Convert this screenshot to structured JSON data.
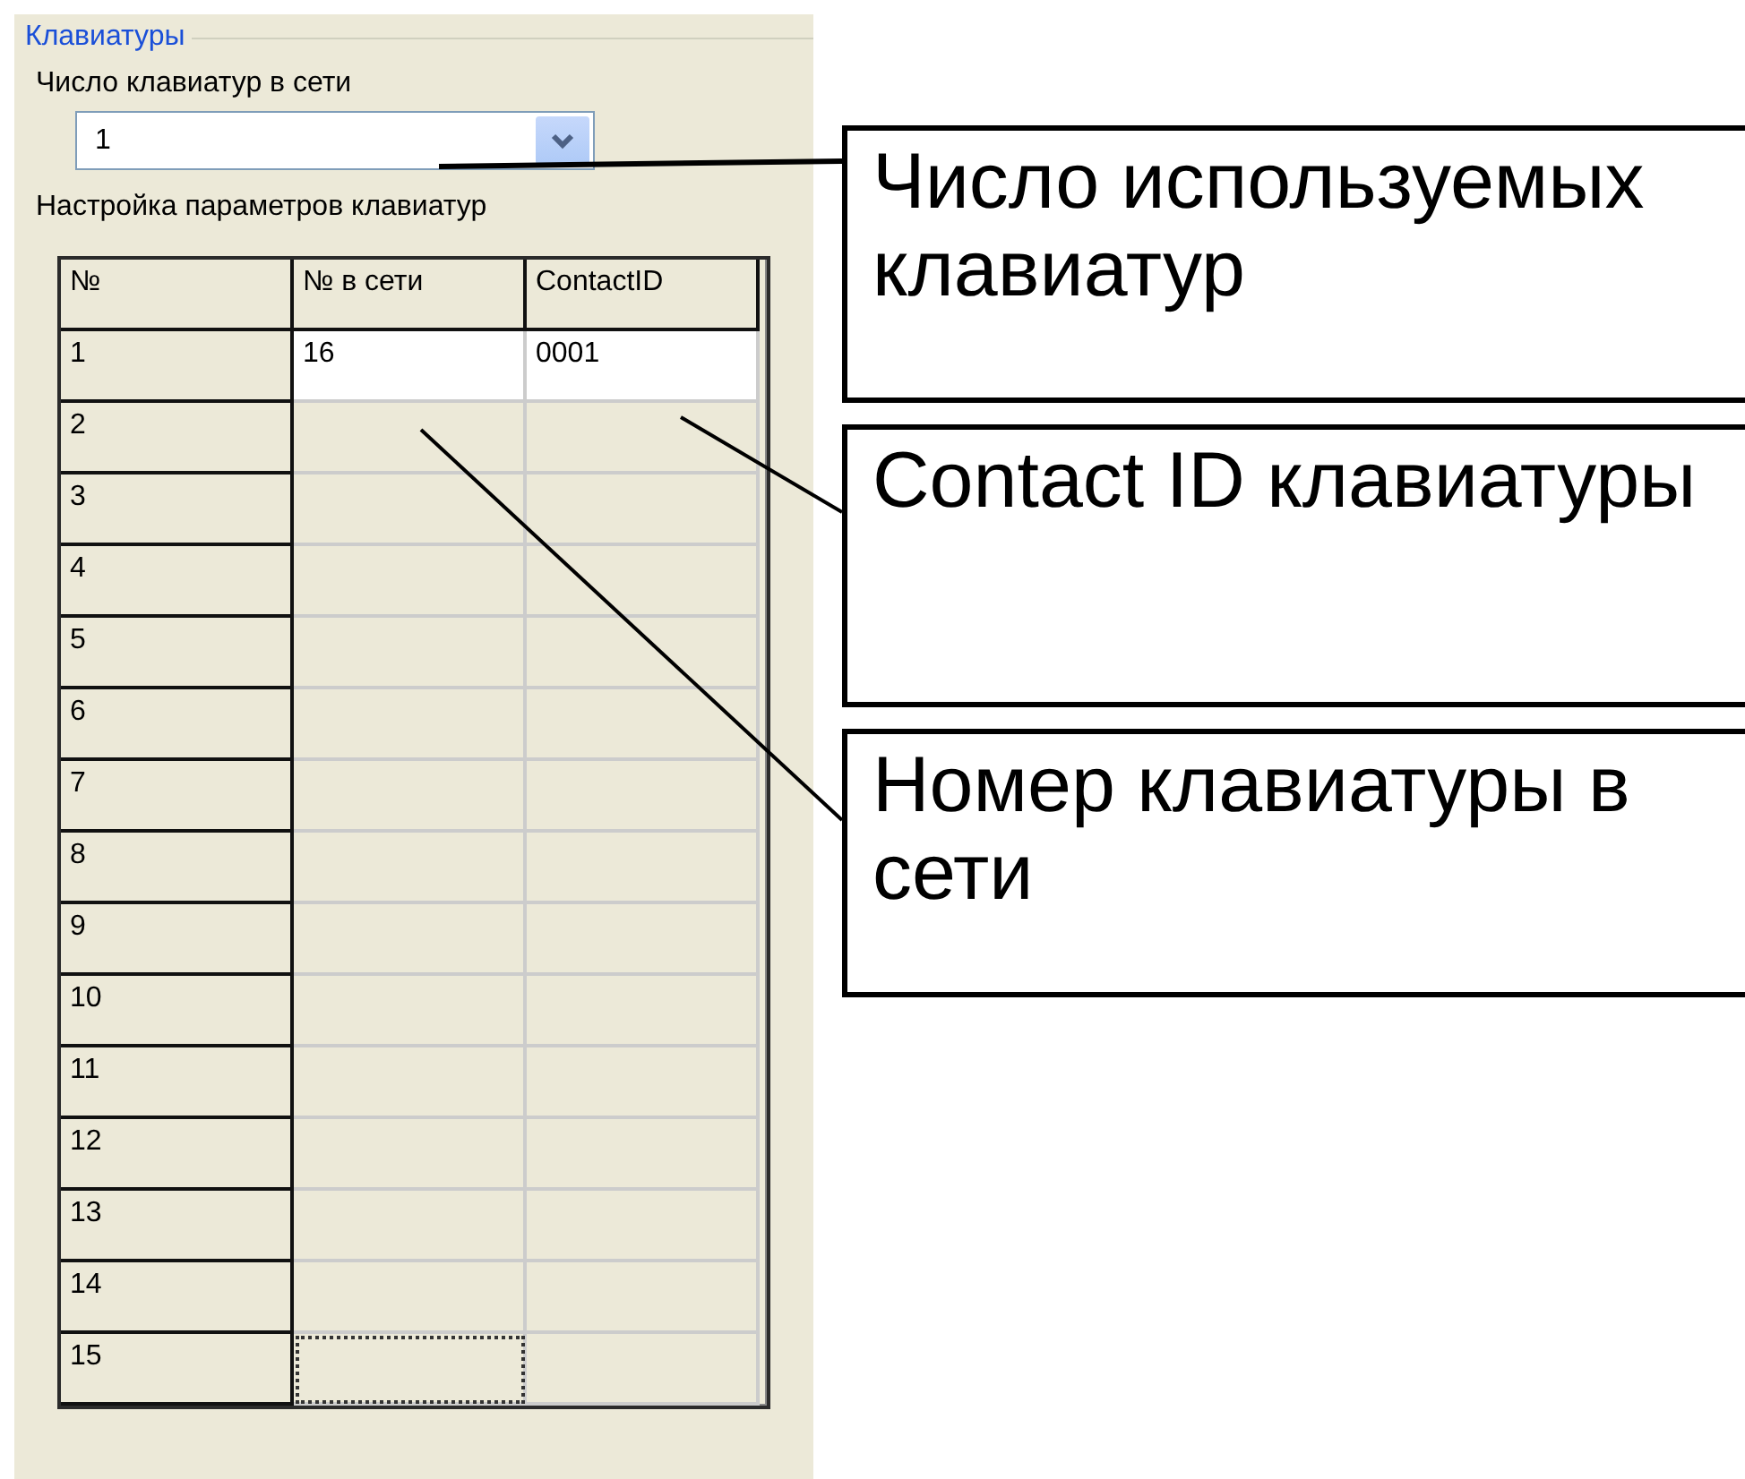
{
  "group": {
    "title": "Клавиатуры"
  },
  "count_label": "Число клавиатур в сети",
  "count_combo": {
    "value": "1"
  },
  "table_label": "Настройка параметров клавиатур",
  "table": {
    "columns": [
      "№",
      "№ в сети",
      "ContactID"
    ],
    "rows": [
      {
        "cells": [
          "1",
          "16",
          "0001"
        ],
        "selected": true,
        "focused": false
      },
      {
        "cells": [
          "2",
          "",
          ""
        ],
        "selected": false,
        "focused": false
      },
      {
        "cells": [
          "3",
          "",
          ""
        ],
        "selected": false,
        "focused": false
      },
      {
        "cells": [
          "4",
          "",
          ""
        ],
        "selected": false,
        "focused": false
      },
      {
        "cells": [
          "5",
          "",
          ""
        ],
        "selected": false,
        "focused": false
      },
      {
        "cells": [
          "6",
          "",
          ""
        ],
        "selected": false,
        "focused": false
      },
      {
        "cells": [
          "7",
          "",
          ""
        ],
        "selected": false,
        "focused": false
      },
      {
        "cells": [
          "8",
          "",
          ""
        ],
        "selected": false,
        "focused": false
      },
      {
        "cells": [
          "9",
          "",
          ""
        ],
        "selected": false,
        "focused": false
      },
      {
        "cells": [
          "10",
          "",
          ""
        ],
        "selected": false,
        "focused": false
      },
      {
        "cells": [
          "11",
          "",
          ""
        ],
        "selected": false,
        "focused": false
      },
      {
        "cells": [
          "12",
          "",
          ""
        ],
        "selected": false,
        "focused": false
      },
      {
        "cells": [
          "13",
          "",
          ""
        ],
        "selected": false,
        "focused": false
      },
      {
        "cells": [
          "14",
          "",
          ""
        ],
        "selected": false,
        "focused": false
      },
      {
        "cells": [
          "15",
          "",
          ""
        ],
        "selected": false,
        "focused": true
      }
    ]
  },
  "callouts": [
    "Число используемых клавиатур",
    "Contact ID клавиатуры",
    "Номер клавиатуры в сети"
  ]
}
